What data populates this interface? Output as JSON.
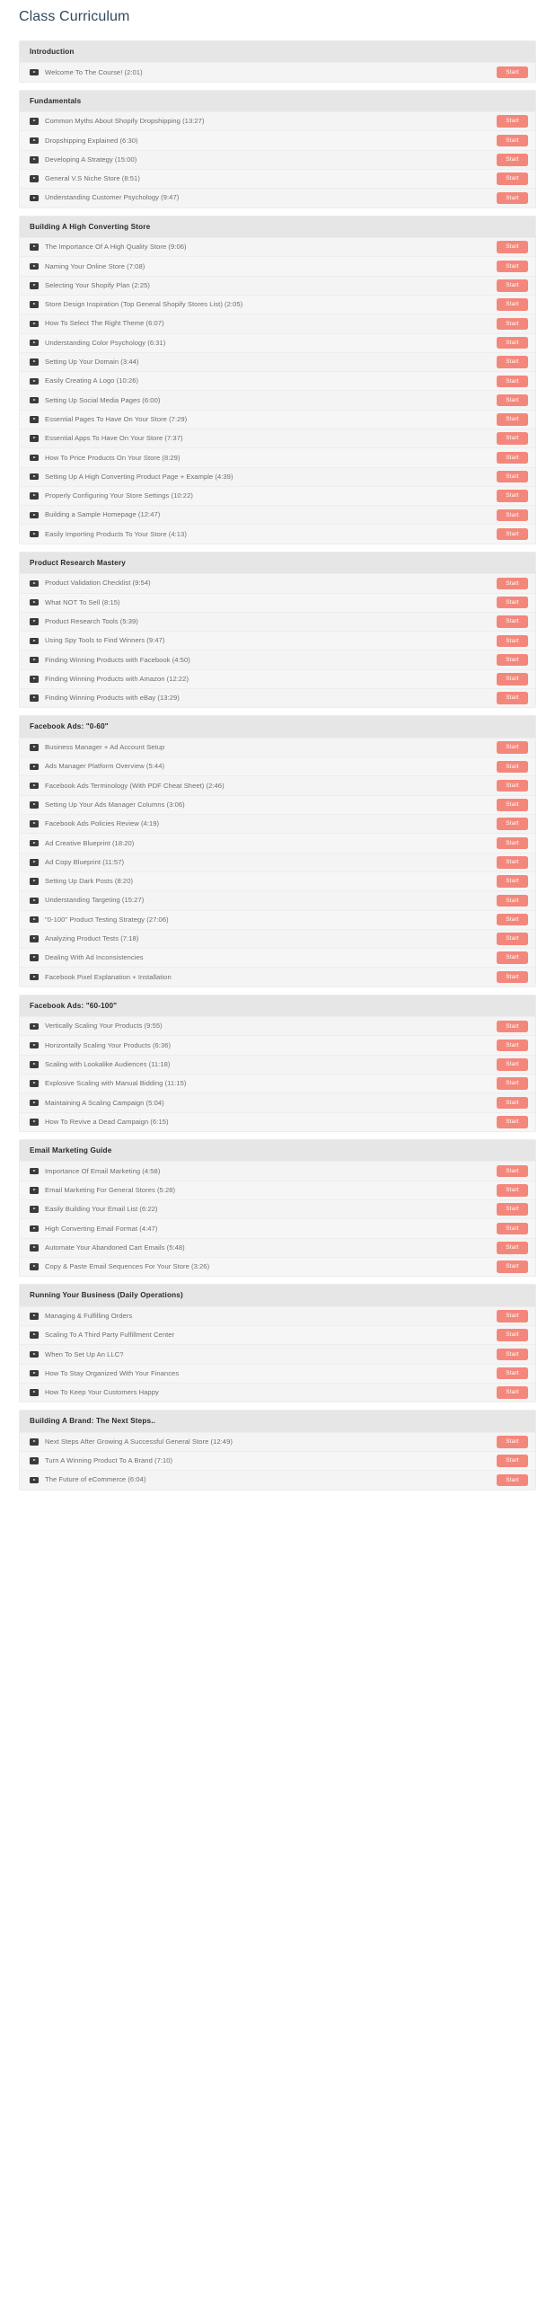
{
  "page": {
    "title": "Class Curriculum",
    "button_label": "Start",
    "icon": "video-play-icon"
  },
  "theme": {
    "accent": "#f4877b",
    "title_color": "#34495e",
    "section_header_bg": "#e6e6e6",
    "row_bg": "#f6f6f6",
    "text_color": "#6e6e6e"
  },
  "sections": [
    {
      "title": "Introduction",
      "lessons": [
        {
          "title": "Welcome To The Course! (2:01)",
          "action": "Start"
        }
      ]
    },
    {
      "title": "Fundamentals",
      "lessons": [
        {
          "title": "Common Myths About Shopify Dropshipping (13:27)",
          "action": "Start"
        },
        {
          "title": "Dropshipping Explained (6:30)",
          "action": "Start"
        },
        {
          "title": "Developing A Strategy (15:00)",
          "action": "Start"
        },
        {
          "title": "General V.S Niche Store (8:51)",
          "action": "Start"
        },
        {
          "title": "Understanding Customer Psychology (9:47)",
          "action": "Start"
        }
      ]
    },
    {
      "title": "Building A High Converting Store",
      "lessons": [
        {
          "title": "The Importance Of A High Quality Store (9:06)",
          "action": "Start"
        },
        {
          "title": "Naming Your Online Store (7:08)",
          "action": "Start"
        },
        {
          "title": "Selecting Your Shopify Plan (2:25)",
          "action": "Start"
        },
        {
          "title": "Store Design Inspiration (Top General Shopify Stores List) (2:05)",
          "action": "Start"
        },
        {
          "title": "How To Select The Right Theme (6:07)",
          "action": "Start"
        },
        {
          "title": "Understanding Color Psychology (6:31)",
          "action": "Start"
        },
        {
          "title": "Setting Up Your Domain (3:44)",
          "action": "Start"
        },
        {
          "title": "Easily Creating A Logo (10:26)",
          "action": "Start"
        },
        {
          "title": "Setting Up Social Media Pages (6:00)",
          "action": "Start"
        },
        {
          "title": "Essential Pages To Have On Your Store (7:29)",
          "action": "Start"
        },
        {
          "title": "Essential Apps To Have On Your Store (7:37)",
          "action": "Start"
        },
        {
          "title": "How To Price Products On Your Store (8:29)",
          "action": "Start"
        },
        {
          "title": "Setting Up A High Converting Product Page + Example (4:39)",
          "action": "Start"
        },
        {
          "title": "Properly Configuring Your Store Settings (10:22)",
          "action": "Start"
        },
        {
          "title": "Building a Sample Homepage (12:47)",
          "action": "Start"
        },
        {
          "title": "Easily Importing Products To Your Store (4:13)",
          "action": "Start"
        }
      ]
    },
    {
      "title": "Product Research Mastery",
      "lessons": [
        {
          "title": "Product Validation Checklist (9:54)",
          "action": "Start"
        },
        {
          "title": "What NOT To Sell (8:15)",
          "action": "Start"
        },
        {
          "title": "Product Research Tools (5:39)",
          "action": "Start"
        },
        {
          "title": "Using Spy Tools to Find Winners (9:47)",
          "action": "Start"
        },
        {
          "title": "Finding Winning Products with Facebook (4:50)",
          "action": "Start"
        },
        {
          "title": "Finding Winning Products with Amazon (12:22)",
          "action": "Start"
        },
        {
          "title": "Finding Winning Products with eBay (13:29)",
          "action": "Start"
        }
      ]
    },
    {
      "title": "Facebook Ads: \"0-60\"",
      "lessons": [
        {
          "title": "Business Manager + Ad Account Setup",
          "action": "Start"
        },
        {
          "title": "Ads Manager Platform Overview (5:44)",
          "action": "Start"
        },
        {
          "title": "Facebook Ads Terminology (With PDF Cheat Sheet) (2:46)",
          "action": "Start"
        },
        {
          "title": "Setting Up Your Ads Manager Columns (3:06)",
          "action": "Start"
        },
        {
          "title": "Facebook Ads Policies Review (4:19)",
          "action": "Start"
        },
        {
          "title": "Ad Creative Blueprint (18:20)",
          "action": "Start"
        },
        {
          "title": "Ad Copy Blueprint (11:57)",
          "action": "Start"
        },
        {
          "title": "Setting Up Dark Posts (8:20)",
          "action": "Start"
        },
        {
          "title": "Understanding Targeting (15:27)",
          "action": "Start"
        },
        {
          "title": "\"0-100\" Product Testing Strategy (27:06)",
          "action": "Start"
        },
        {
          "title": "Analyzing Product Tests (7:18)",
          "action": "Start"
        },
        {
          "title": "Dealing With Ad Inconsistencies",
          "action": "Start"
        },
        {
          "title": "Facebook Pixel Explanation + Installation",
          "action": "Start"
        }
      ]
    },
    {
      "title": "Facebook Ads: \"60-100\"",
      "lessons": [
        {
          "title": "Vertically Scaling Your Products (9:55)",
          "action": "Start"
        },
        {
          "title": "Horizontally Scaling Your Products (6:36)",
          "action": "Start"
        },
        {
          "title": "Scaling with Lookalike Audiences (11:18)",
          "action": "Start"
        },
        {
          "title": "Explosive Scaling with Manual Bidding (11:15)",
          "action": "Start"
        },
        {
          "title": "Maintaining A Scaling Campaign (5:04)",
          "action": "Start"
        },
        {
          "title": "How To Revive a Dead Campaign (6:15)",
          "action": "Start"
        }
      ]
    },
    {
      "title": "Email Marketing Guide",
      "lessons": [
        {
          "title": "Importance Of Email Marketing (4:58)",
          "action": "Start"
        },
        {
          "title": "Email Marketing For General Stores (5:28)",
          "action": "Start"
        },
        {
          "title": "Easily Building Your Email List (6:22)",
          "action": "Start"
        },
        {
          "title": "High Converting Email Format (4:47)",
          "action": "Start"
        },
        {
          "title": "Automate Your Abandoned Cart Emails (5:48)",
          "action": "Start"
        },
        {
          "title": "Copy & Paste Email Sequences For Your Store (3:26)",
          "action": "Start"
        }
      ]
    },
    {
      "title": "Running Your Business (Daily Operations)",
      "lessons": [
        {
          "title": "Managing & Fulfilling Orders",
          "action": "Start"
        },
        {
          "title": "Scaling To A Third Party Fulfillment Center",
          "action": "Start"
        },
        {
          "title": "When To Set Up An LLC?",
          "action": "Start"
        },
        {
          "title": "How To Stay Organized With Your Finances",
          "action": "Start"
        },
        {
          "title": "How To Keep Your Customers Happy",
          "action": "Start"
        }
      ]
    },
    {
      "title": "Building A Brand: The Next Steps..",
      "lessons": [
        {
          "title": "Next Steps After Growing A Successful General Store (12:49)",
          "action": "Start"
        },
        {
          "title": "Turn A Winning Product To A Brand (7:10)",
          "action": "Start"
        },
        {
          "title": "The Future of eCommerce (6:04)",
          "action": "Start"
        }
      ]
    }
  ]
}
